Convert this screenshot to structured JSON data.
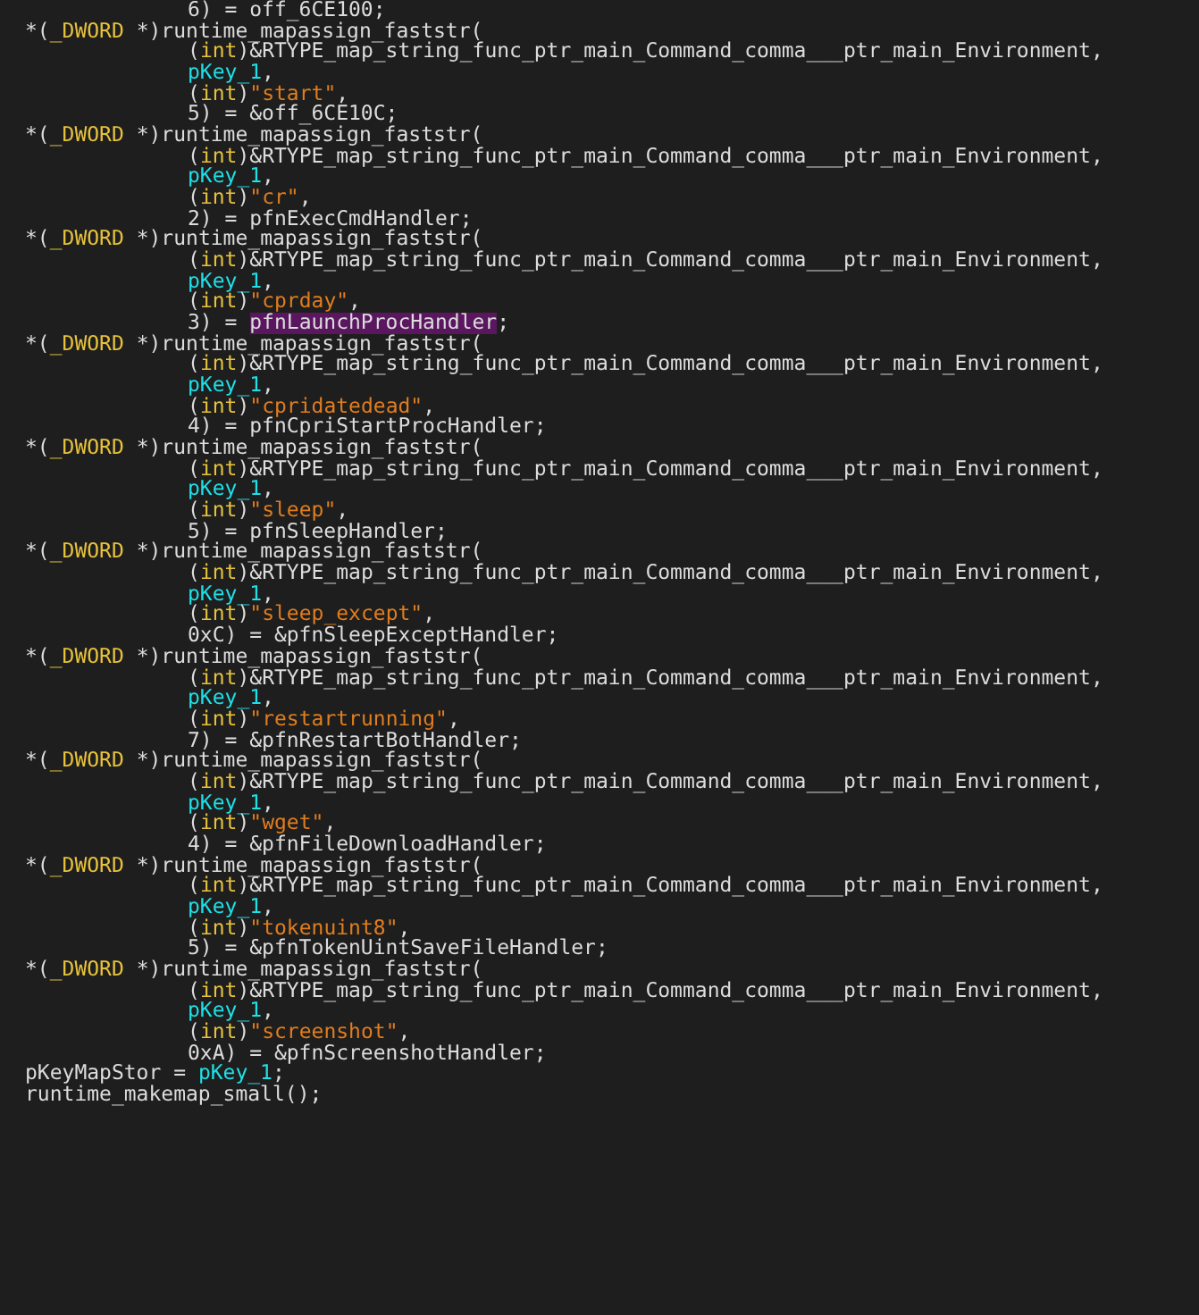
{
  "lines": [
    {
      "kind": "argument",
      "tokens": [
        {
          "text": "6) = off_6CE100;",
          "kind": "plain"
        }
      ]
    },
    {
      "kind": "statement",
      "tokens": [
        {
          "text": "*(",
          "kind": "plain"
        },
        {
          "text": "_DWORD",
          "kind": "type"
        },
        {
          "text": " *)runtime_mapassign_faststr(",
          "kind": "plain"
        }
      ]
    },
    {
      "kind": "argument",
      "tokens": [
        {
          "text": "(",
          "kind": "plain"
        },
        {
          "text": "int",
          "kind": "type"
        },
        {
          "text": ")&RTYPE_map_string_func_ptr_main_Command_comma___ptr_main_Environment,",
          "kind": "plain"
        }
      ]
    },
    {
      "kind": "argument",
      "tokens": [
        {
          "text": "pKey_1",
          "kind": "global"
        },
        {
          "text": ",",
          "kind": "plain"
        }
      ]
    },
    {
      "kind": "argument",
      "tokens": [
        {
          "text": "(",
          "kind": "plain"
        },
        {
          "text": "int",
          "kind": "type"
        },
        {
          "text": ")",
          "kind": "plain"
        },
        {
          "text": "\"start\"",
          "kind": "string"
        },
        {
          "text": ",",
          "kind": "plain"
        }
      ]
    },
    {
      "kind": "argument",
      "tokens": [
        {
          "text": "5) = &off_6CE10C;",
          "kind": "plain"
        }
      ]
    },
    {
      "kind": "statement",
      "tokens": [
        {
          "text": "*(",
          "kind": "plain"
        },
        {
          "text": "_DWORD",
          "kind": "type"
        },
        {
          "text": " *)runtime_mapassign_faststr(",
          "kind": "plain"
        }
      ]
    },
    {
      "kind": "argument",
      "tokens": [
        {
          "text": "(",
          "kind": "plain"
        },
        {
          "text": "int",
          "kind": "type"
        },
        {
          "text": ")&RTYPE_map_string_func_ptr_main_Command_comma___ptr_main_Environment,",
          "kind": "plain"
        }
      ]
    },
    {
      "kind": "argument",
      "tokens": [
        {
          "text": "pKey_1",
          "kind": "global"
        },
        {
          "text": ",",
          "kind": "plain"
        }
      ]
    },
    {
      "kind": "argument",
      "tokens": [
        {
          "text": "(",
          "kind": "plain"
        },
        {
          "text": "int",
          "kind": "type"
        },
        {
          "text": ")",
          "kind": "plain"
        },
        {
          "text": "\"cr\"",
          "kind": "string"
        },
        {
          "text": ",",
          "kind": "plain"
        }
      ]
    },
    {
      "kind": "argument",
      "tokens": [
        {
          "text": "2) = pfnExecCmdHandler;",
          "kind": "plain"
        }
      ]
    },
    {
      "kind": "statement",
      "tokens": [
        {
          "text": "*(",
          "kind": "plain"
        },
        {
          "text": "_DWORD",
          "kind": "type"
        },
        {
          "text": " *)runtime_mapassign_faststr(",
          "kind": "plain"
        }
      ]
    },
    {
      "kind": "argument",
      "tokens": [
        {
          "text": "(",
          "kind": "plain"
        },
        {
          "text": "int",
          "kind": "type"
        },
        {
          "text": ")&RTYPE_map_string_func_ptr_main_Command_comma___ptr_main_Environment,",
          "kind": "plain"
        }
      ]
    },
    {
      "kind": "argument",
      "tokens": [
        {
          "text": "pKey_1",
          "kind": "global"
        },
        {
          "text": ",",
          "kind": "plain"
        }
      ]
    },
    {
      "kind": "argument",
      "tokens": [
        {
          "text": "(",
          "kind": "plain"
        },
        {
          "text": "int",
          "kind": "type"
        },
        {
          "text": ")",
          "kind": "plain"
        },
        {
          "text": "\"cprday\"",
          "kind": "string"
        },
        {
          "text": ",",
          "kind": "plain"
        }
      ]
    },
    {
      "kind": "argument",
      "tokens": [
        {
          "text": "3) = ",
          "kind": "plain"
        },
        {
          "text": "pfnLaunchProcHandler",
          "kind": "highlight"
        },
        {
          "text": ";",
          "kind": "plain"
        }
      ]
    },
    {
      "kind": "statement",
      "tokens": [
        {
          "text": "*(",
          "kind": "plain"
        },
        {
          "text": "_DWORD",
          "kind": "type"
        },
        {
          "text": " *)runtime_mapassign_faststr(",
          "kind": "plain"
        }
      ]
    },
    {
      "kind": "argument",
      "tokens": [
        {
          "text": "(",
          "kind": "plain"
        },
        {
          "text": "int",
          "kind": "type"
        },
        {
          "text": ")&RTYPE_map_string_func_ptr_main_Command_comma___ptr_main_Environment,",
          "kind": "plain"
        }
      ]
    },
    {
      "kind": "argument",
      "tokens": [
        {
          "text": "pKey_1",
          "kind": "global"
        },
        {
          "text": ",",
          "kind": "plain"
        }
      ]
    },
    {
      "kind": "argument",
      "tokens": [
        {
          "text": "(",
          "kind": "plain"
        },
        {
          "text": "int",
          "kind": "type"
        },
        {
          "text": ")",
          "kind": "plain"
        },
        {
          "text": "\"cpridatedead\"",
          "kind": "string"
        },
        {
          "text": ",",
          "kind": "plain"
        }
      ]
    },
    {
      "kind": "argument",
      "tokens": [
        {
          "text": "4) = pfnCpriStartProcHandler;",
          "kind": "plain"
        }
      ]
    },
    {
      "kind": "statement",
      "tokens": [
        {
          "text": "*(",
          "kind": "plain"
        },
        {
          "text": "_DWORD",
          "kind": "type"
        },
        {
          "text": " *)runtime_mapassign_faststr(",
          "kind": "plain"
        }
      ]
    },
    {
      "kind": "argument",
      "tokens": [
        {
          "text": "(",
          "kind": "plain"
        },
        {
          "text": "int",
          "kind": "type"
        },
        {
          "text": ")&RTYPE_map_string_func_ptr_main_Command_comma___ptr_main_Environment,",
          "kind": "plain"
        }
      ]
    },
    {
      "kind": "argument",
      "tokens": [
        {
          "text": "pKey_1",
          "kind": "global"
        },
        {
          "text": ",",
          "kind": "plain"
        }
      ]
    },
    {
      "kind": "argument",
      "tokens": [
        {
          "text": "(",
          "kind": "plain"
        },
        {
          "text": "int",
          "kind": "type"
        },
        {
          "text": ")",
          "kind": "plain"
        },
        {
          "text": "\"sleep\"",
          "kind": "string"
        },
        {
          "text": ",",
          "kind": "plain"
        }
      ]
    },
    {
      "kind": "argument",
      "tokens": [
        {
          "text": "5) = pfnSleepHandler;",
          "kind": "plain"
        }
      ]
    },
    {
      "kind": "statement",
      "tokens": [
        {
          "text": "*(",
          "kind": "plain"
        },
        {
          "text": "_DWORD",
          "kind": "type"
        },
        {
          "text": " *)runtime_mapassign_faststr(",
          "kind": "plain"
        }
      ]
    },
    {
      "kind": "argument",
      "tokens": [
        {
          "text": "(",
          "kind": "plain"
        },
        {
          "text": "int",
          "kind": "type"
        },
        {
          "text": ")&RTYPE_map_string_func_ptr_main_Command_comma___ptr_main_Environment,",
          "kind": "plain"
        }
      ]
    },
    {
      "kind": "argument",
      "tokens": [
        {
          "text": "pKey_1",
          "kind": "global"
        },
        {
          "text": ",",
          "kind": "plain"
        }
      ]
    },
    {
      "kind": "argument",
      "tokens": [
        {
          "text": "(",
          "kind": "plain"
        },
        {
          "text": "int",
          "kind": "type"
        },
        {
          "text": ")",
          "kind": "plain"
        },
        {
          "text": "\"sleep_except\"",
          "kind": "string"
        },
        {
          "text": ",",
          "kind": "plain"
        }
      ]
    },
    {
      "kind": "argument",
      "tokens": [
        {
          "text": "0xC) = &pfnSleepExceptHandler;",
          "kind": "plain"
        }
      ]
    },
    {
      "kind": "statement",
      "tokens": [
        {
          "text": "*(",
          "kind": "plain"
        },
        {
          "text": "_DWORD",
          "kind": "type"
        },
        {
          "text": " *)runtime_mapassign_faststr(",
          "kind": "plain"
        }
      ]
    },
    {
      "kind": "argument",
      "tokens": [
        {
          "text": "(",
          "kind": "plain"
        },
        {
          "text": "int",
          "kind": "type"
        },
        {
          "text": ")&RTYPE_map_string_func_ptr_main_Command_comma___ptr_main_Environment,",
          "kind": "plain"
        }
      ]
    },
    {
      "kind": "argument",
      "tokens": [
        {
          "text": "pKey_1",
          "kind": "global"
        },
        {
          "text": ",",
          "kind": "plain"
        }
      ]
    },
    {
      "kind": "argument",
      "tokens": [
        {
          "text": "(",
          "kind": "plain"
        },
        {
          "text": "int",
          "kind": "type"
        },
        {
          "text": ")",
          "kind": "plain"
        },
        {
          "text": "\"restartrunning\"",
          "kind": "string"
        },
        {
          "text": ",",
          "kind": "plain"
        }
      ]
    },
    {
      "kind": "argument",
      "tokens": [
        {
          "text": "7) = &pfnRestartBotHandler;",
          "kind": "plain"
        }
      ]
    },
    {
      "kind": "statement",
      "tokens": [
        {
          "text": "*(",
          "kind": "plain"
        },
        {
          "text": "_DWORD",
          "kind": "type"
        },
        {
          "text": " *)runtime_mapassign_faststr(",
          "kind": "plain"
        }
      ]
    },
    {
      "kind": "argument",
      "tokens": [
        {
          "text": "(",
          "kind": "plain"
        },
        {
          "text": "int",
          "kind": "type"
        },
        {
          "text": ")&RTYPE_map_string_func_ptr_main_Command_comma___ptr_main_Environment,",
          "kind": "plain"
        }
      ]
    },
    {
      "kind": "argument",
      "tokens": [
        {
          "text": "pKey_1",
          "kind": "global"
        },
        {
          "text": ",",
          "kind": "plain"
        }
      ]
    },
    {
      "kind": "argument",
      "tokens": [
        {
          "text": "(",
          "kind": "plain"
        },
        {
          "text": "int",
          "kind": "type"
        },
        {
          "text": ")",
          "kind": "plain"
        },
        {
          "text": "\"wget\"",
          "kind": "string"
        },
        {
          "text": ",",
          "kind": "plain"
        }
      ]
    },
    {
      "kind": "argument",
      "tokens": [
        {
          "text": "4) = &pfnFileDownloadHandler;",
          "kind": "plain"
        }
      ]
    },
    {
      "kind": "statement",
      "tokens": [
        {
          "text": "*(",
          "kind": "plain"
        },
        {
          "text": "_DWORD",
          "kind": "type"
        },
        {
          "text": " *)runtime_mapassign_faststr(",
          "kind": "plain"
        }
      ]
    },
    {
      "kind": "argument",
      "tokens": [
        {
          "text": "(",
          "kind": "plain"
        },
        {
          "text": "int",
          "kind": "type"
        },
        {
          "text": ")&RTYPE_map_string_func_ptr_main_Command_comma___ptr_main_Environment,",
          "kind": "plain"
        }
      ]
    },
    {
      "kind": "argument",
      "tokens": [
        {
          "text": "pKey_1",
          "kind": "global"
        },
        {
          "text": ",",
          "kind": "plain"
        }
      ]
    },
    {
      "kind": "argument",
      "tokens": [
        {
          "text": "(",
          "kind": "plain"
        },
        {
          "text": "int",
          "kind": "type"
        },
        {
          "text": ")",
          "kind": "plain"
        },
        {
          "text": "\"tokenuint8\"",
          "kind": "string"
        },
        {
          "text": ",",
          "kind": "plain"
        }
      ]
    },
    {
      "kind": "argument",
      "tokens": [
        {
          "text": "5) = &pfnTokenUintSaveFileHandler;",
          "kind": "plain"
        }
      ]
    },
    {
      "kind": "statement",
      "tokens": [
        {
          "text": "*(",
          "kind": "plain"
        },
        {
          "text": "_DWORD",
          "kind": "type"
        },
        {
          "text": " *)runtime_mapassign_faststr(",
          "kind": "plain"
        }
      ]
    },
    {
      "kind": "argument",
      "tokens": [
        {
          "text": "(",
          "kind": "plain"
        },
        {
          "text": "int",
          "kind": "type"
        },
        {
          "text": ")&RTYPE_map_string_func_ptr_main_Command_comma___ptr_main_Environment,",
          "kind": "plain"
        }
      ]
    },
    {
      "kind": "argument",
      "tokens": [
        {
          "text": "pKey_1",
          "kind": "global"
        },
        {
          "text": ",",
          "kind": "plain"
        }
      ]
    },
    {
      "kind": "argument",
      "tokens": [
        {
          "text": "(",
          "kind": "plain"
        },
        {
          "text": "int",
          "kind": "type"
        },
        {
          "text": ")",
          "kind": "plain"
        },
        {
          "text": "\"screenshot\"",
          "kind": "string"
        },
        {
          "text": ",",
          "kind": "plain"
        }
      ]
    },
    {
      "kind": "argument",
      "tokens": [
        {
          "text": "0xA) = &pfnScreenshotHandler;",
          "kind": "plain"
        }
      ]
    },
    {
      "kind": "statement",
      "tokens": [
        {
          "text": "pKeyMapStor = ",
          "kind": "plain"
        },
        {
          "text": "pKey_1",
          "kind": "global"
        },
        {
          "text": ";",
          "kind": "plain"
        }
      ]
    },
    {
      "kind": "statement",
      "tokens": [
        {
          "text": "runtime_makemap_small();",
          "kind": "plain"
        }
      ]
    }
  ]
}
